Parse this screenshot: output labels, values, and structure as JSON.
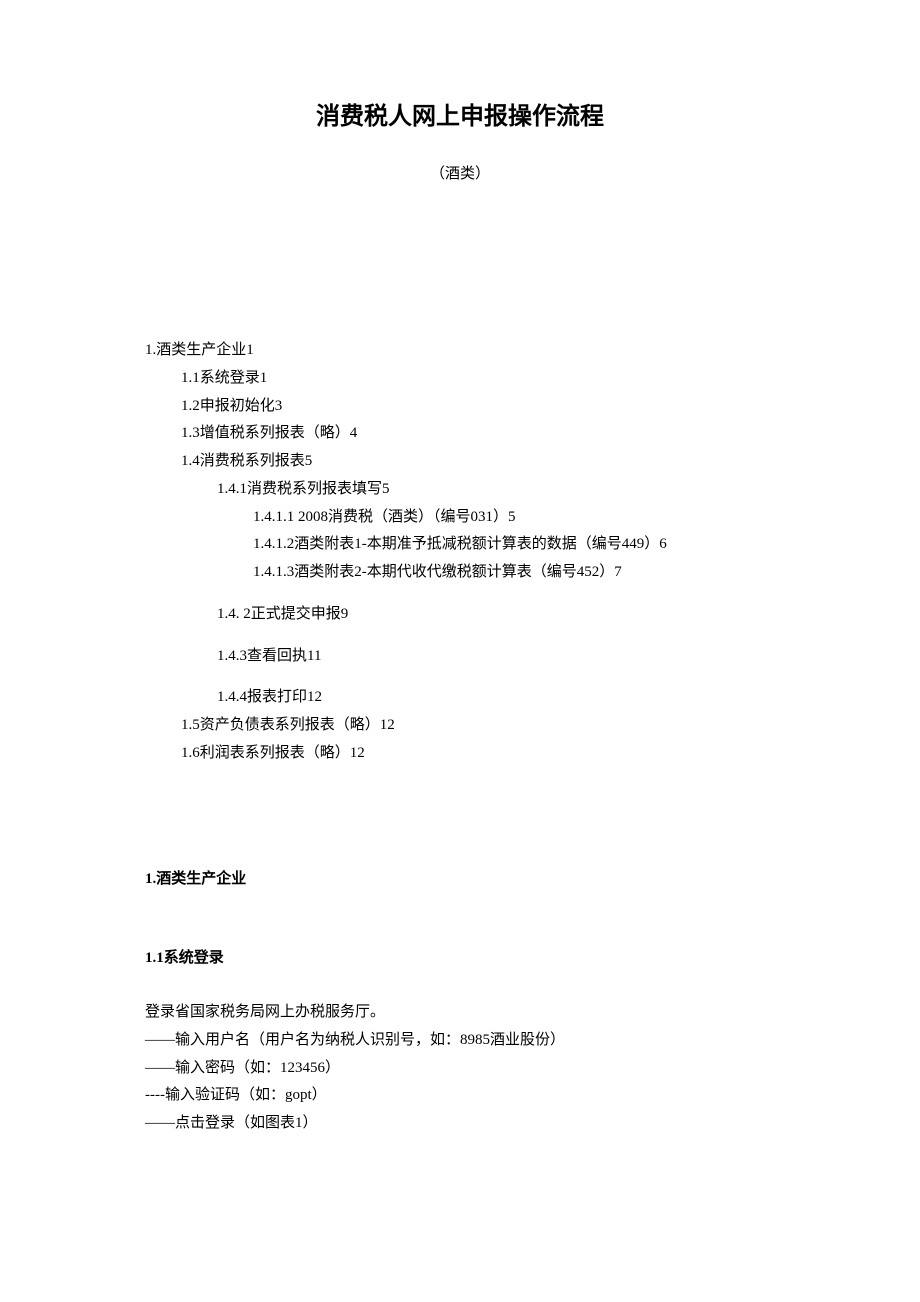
{
  "title": "消费税人网上申报操作流程",
  "subtitle": "（酒类）",
  "toc": {
    "l1_1": "1.酒类生产企业1",
    "l2_1": "1.1系统登录1",
    "l2_2": "1.2申报初始化3",
    "l2_3": "1.3增值税系列报表（略）4",
    "l2_4": "1.4消费税系列报表5",
    "l3_1": "1.4.1消费税系列报表填写5",
    "l4_1": "1.4.1.1 2008消费税（酒类）（编号031）5",
    "l4_2": "1.4.1.2酒类附表1-本期准予抵减税额计算表的数据（编号449）6",
    "l4_3": "1.4.1.3酒类附表2-本期代收代缴税额计算表（编号452）7",
    "l3_2": "1.4. 2正式提交申报9",
    "l3_3": "1.4.3查看回执11",
    "l3_4": "1.4.4报表打印12",
    "l2_5": "1.5资产负债表系列报表（略）12",
    "l2_6": "1.6利润表系列报表（略）12"
  },
  "section1_heading": "1.酒类生产企业",
  "section1_1_heading": "1.1系统登录",
  "body": {
    "line1": "登录省国家税务局网上办税服务厅。",
    "line2": "——输入用户名（用户名为纳税人识别号，如：8985酒业股份）",
    "line3": "——输入密码（如：123456）",
    "line4": " ----输入验证码（如：gopt）",
    "line5": "——点击登录（如图表1）"
  }
}
